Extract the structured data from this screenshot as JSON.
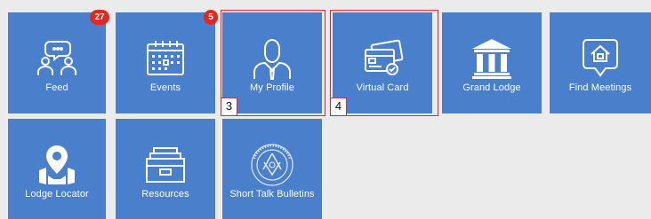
{
  "tiles": {
    "feed": {
      "label": "Feed",
      "badge": "27",
      "icon": "chat-users-icon"
    },
    "events": {
      "label": "Events",
      "badge": "5",
      "icon": "calendar-icon"
    },
    "my_profile": {
      "label": "My Profile",
      "icon": "person-icon"
    },
    "virtual_card": {
      "label": "Virtual Card",
      "icon": "credit-card-icon"
    },
    "grand_lodge": {
      "label": "Grand Lodge",
      "icon": "temple-icon"
    },
    "find_meetings": {
      "label": "Find Meetings",
      "icon": "home-pin-icon"
    },
    "lodge_locator": {
      "label": "Lodge Locator",
      "icon": "map-pin-icon"
    },
    "resources": {
      "label": "Resources",
      "icon": "file-drawer-icon"
    },
    "short_talk_bulletins": {
      "label": "Short Talk Bulletins",
      "icon": "masonic-seal-icon"
    }
  },
  "annotations": {
    "my_profile_marker": "3",
    "virtual_card_marker": "4"
  },
  "colors": {
    "tile": "#4a7fcb",
    "badge": "#e02a21",
    "highlight": "#e8232a",
    "background": "#ebebeb"
  }
}
